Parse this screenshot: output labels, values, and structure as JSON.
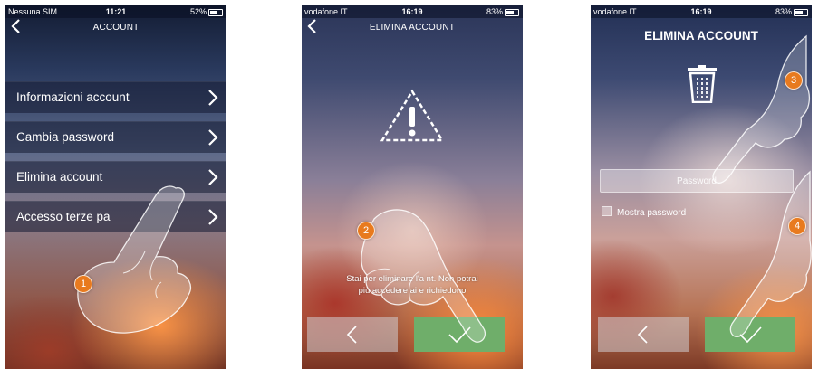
{
  "screens": [
    {
      "status": {
        "carrier": "Nessuna SIM",
        "time": "11:21",
        "battery": "52%"
      },
      "title": "ACCOUNT",
      "menu": [
        {
          "label": "Informazioni account"
        },
        {
          "label": "Cambia password"
        },
        {
          "label": "Elimina account"
        },
        {
          "label": "Accesso terze pa"
        }
      ],
      "badge": "1"
    },
    {
      "status": {
        "carrier": "vodafone IT",
        "time": "16:19",
        "battery": "83%"
      },
      "title": "ELIMINA ACCOUNT",
      "message_line1": "Stai per eliminare l'a        nt. Non potrai",
      "message_line2": "più accedere ai        e richiedono",
      "badge": "2"
    },
    {
      "status": {
        "carrier": "vodafone IT",
        "time": "16:19",
        "battery": "83%"
      },
      "title": "ELIMINA ACCOUNT",
      "password_placeholder": "Password",
      "show_password_label": "Mostra password",
      "badges": [
        "3",
        "4"
      ]
    }
  ],
  "icons": {
    "back": "chevron-left-icon",
    "menu_arrow": "chevron-right-icon",
    "warning": "warning-triangle-icon",
    "trash": "trash-icon",
    "confirm": "checkmark-icon"
  },
  "colors": {
    "confirm_button": "#6fae6a",
    "badge": "#e87a1e"
  }
}
